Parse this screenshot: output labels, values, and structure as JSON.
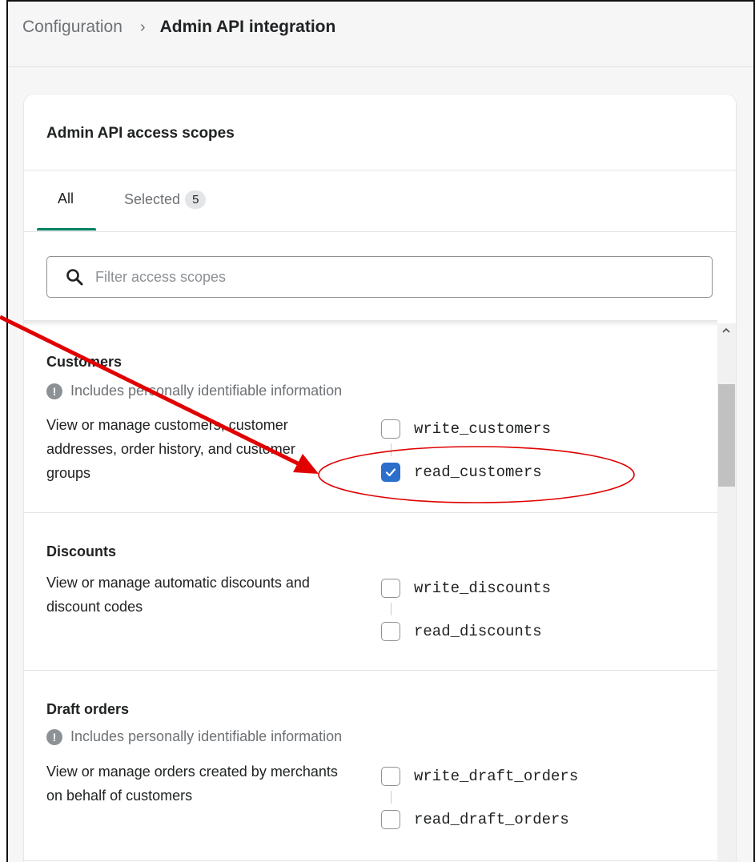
{
  "breadcrumb": {
    "parent": "Configuration",
    "separator": "›",
    "current": "Admin API integration"
  },
  "card": {
    "title": "Admin API access scopes"
  },
  "tabs": [
    {
      "label": "All",
      "active": true
    },
    {
      "label": "Selected",
      "badge": "5",
      "active": false
    }
  ],
  "search": {
    "placeholder": "Filter access scopes",
    "value": ""
  },
  "sections": [
    {
      "title": "Customers",
      "pii_notice": "Includes personally identifiable information",
      "description": "View or manage customers, customer addresses, order history, and customer groups",
      "scopes": [
        {
          "label": "write_customers",
          "checked": false
        },
        {
          "label": "read_customers",
          "checked": true
        }
      ]
    },
    {
      "title": "Discounts",
      "pii_notice": null,
      "description": "View or manage automatic discounts and discount codes",
      "scopes": [
        {
          "label": "write_discounts",
          "checked": false
        },
        {
          "label": "read_discounts",
          "checked": false
        }
      ]
    },
    {
      "title": "Draft orders",
      "pii_notice": "Includes personally identifiable information",
      "description": "View or manage orders created by merchants on behalf of customers",
      "scopes": [
        {
          "label": "write_draft_orders",
          "checked": false
        },
        {
          "label": "read_draft_orders",
          "checked": false
        }
      ]
    }
  ],
  "colors": {
    "accent_tab": "#008060",
    "checkbox_checked": "#2c6ecb",
    "annotation": "#e00000"
  },
  "icons": {
    "search": "search-icon",
    "pii": "exclamation-circle-icon",
    "check": "checkmark-icon",
    "scroll_up": "chevron-up-icon"
  }
}
